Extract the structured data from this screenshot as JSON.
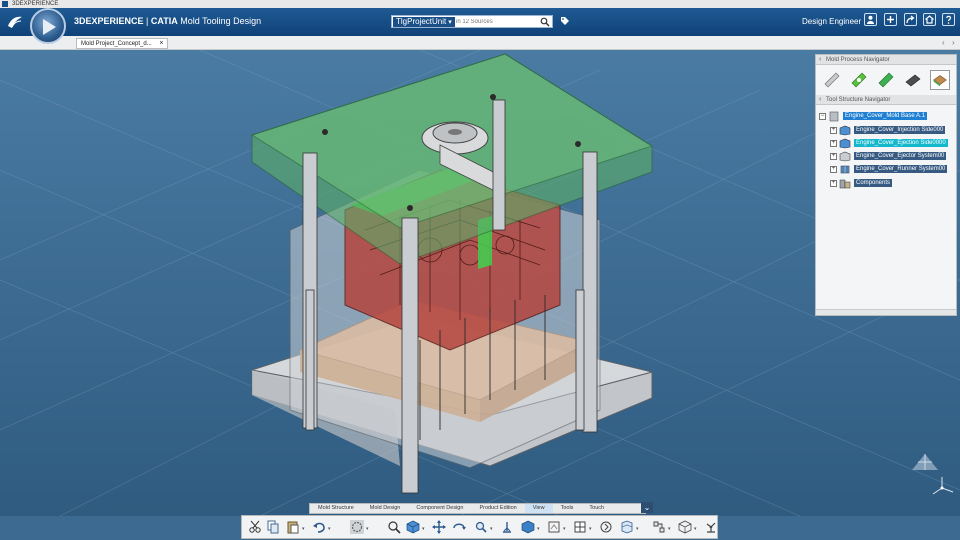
{
  "window": {
    "title": "3DEXPERIENCE"
  },
  "app": {
    "brand": "3DEXPERIENCE",
    "product": "CATIA",
    "module": "Mold Tooling Design",
    "separator": "|"
  },
  "search": {
    "tag": "TlgProjectUnit",
    "placeholder": "in 12 Sources"
  },
  "user": {
    "role": "Design Engineer"
  },
  "document_tabs": [
    {
      "label": "Mold Project_Concept_d...",
      "close": "×"
    }
  ],
  "tab_nav": {
    "left": "‹",
    "right": "›"
  },
  "panel": {
    "process_title": "Mold Process Navigator",
    "structure_title": "Tool Structure Navigator",
    "process_icons": [
      "mold-plate-icon",
      "ejector-icon",
      "gate-icon",
      "runner-icon",
      "cavity-icon"
    ],
    "tree": [
      {
        "label": "Engine_Cover_Mold Base A.1",
        "level": 0,
        "expander": "−",
        "state": "selected"
      },
      {
        "label": "Engine_Cover_Injection Side000",
        "level": 1,
        "expander": "+",
        "state": "normal"
      },
      {
        "label": "Engine_Cover_Ejection Side0000",
        "level": 1,
        "expander": "+",
        "state": "highlight"
      },
      {
        "label": "Engine_Cover_Ejector System00",
        "level": 1,
        "expander": "+",
        "state": "normal"
      },
      {
        "label": "Engine_Cover_Runner System00",
        "level": 1,
        "expander": "+",
        "state": "normal"
      },
      {
        "label": "Components",
        "level": 1,
        "expander": "+",
        "state": "normal"
      }
    ]
  },
  "section_tabs": [
    {
      "label": "Mold Structure",
      "active": false
    },
    {
      "label": "Mold Design",
      "active": false
    },
    {
      "label": "Component Design",
      "active": false
    },
    {
      "label": "Product Edition",
      "active": false
    },
    {
      "label": "View",
      "active": true
    },
    {
      "label": "Tools",
      "active": false
    },
    {
      "label": "Touch",
      "active": false
    }
  ],
  "section_chevron": "⌄",
  "toolbar_icons": [
    "cut-icon",
    "copy-icon",
    "paste-icon",
    "undo-icon",
    "select-icon",
    "zoom-icon",
    "cube-view-icon",
    "pan-icon",
    "rotate-icon",
    "zoom-area-icon",
    "normal-view-icon",
    "iso-view-icon",
    "render-style-icon",
    "section-icon",
    "grid-icon",
    "fly-icon",
    "compass-icon",
    "tree-icon",
    "measure-icon",
    "robot-icon"
  ],
  "colors": {
    "background": "#3c6a91",
    "topbar": "#174c85",
    "top_plate": "#5cae68",
    "cavity": "#b4453f",
    "ejector_plate": "#e7a266",
    "mold_body": "#c4c8cc"
  }
}
